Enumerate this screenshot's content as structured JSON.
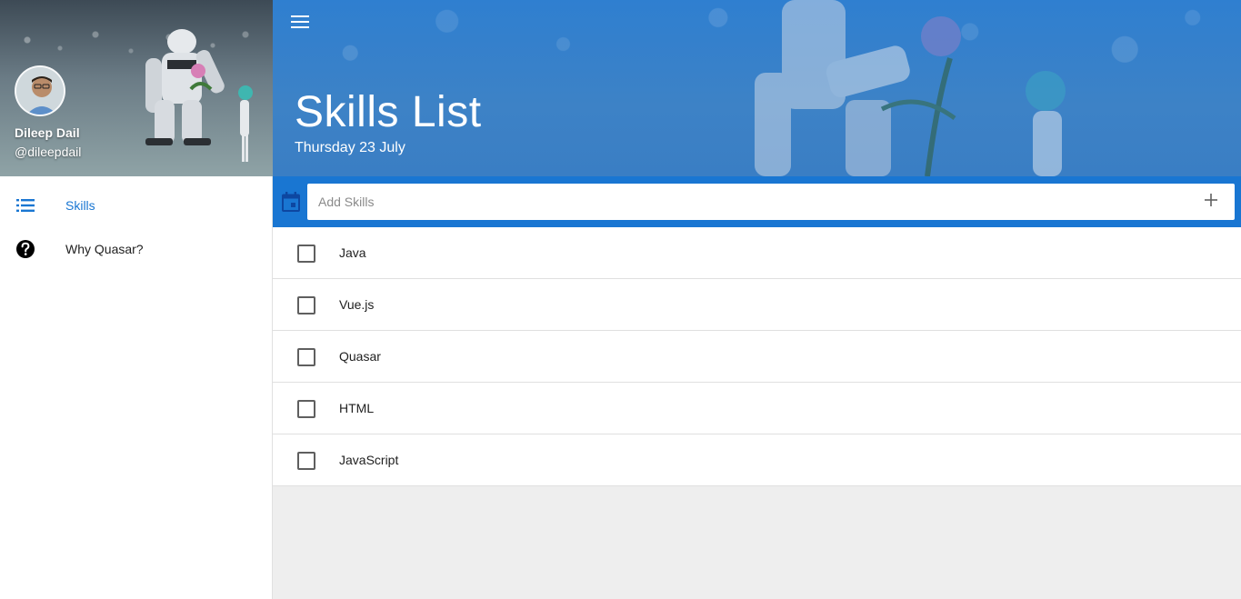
{
  "drawer": {
    "user": {
      "name": "Dileep Dail",
      "handle": "@dileepdail"
    },
    "nav": [
      {
        "label": "Skills",
        "icon": "list-icon",
        "active": true
      },
      {
        "label": "Why Quasar?",
        "icon": "help-circle-icon",
        "active": false
      }
    ]
  },
  "header": {
    "title": "Skills List",
    "date": "Thursday 23 July"
  },
  "add_skill": {
    "placeholder": "Add Skills",
    "value": ""
  },
  "skills": [
    {
      "label": "Java",
      "done": false
    },
    {
      "label": "Vue.js",
      "done": false
    },
    {
      "label": "Quasar",
      "done": false
    },
    {
      "label": "HTML",
      "done": false
    },
    {
      "label": "JavaScript",
      "done": false
    }
  ],
  "colors": {
    "primary": "#1976d2",
    "content_background": "#eeeeee",
    "divider": "#e0e0e0"
  }
}
